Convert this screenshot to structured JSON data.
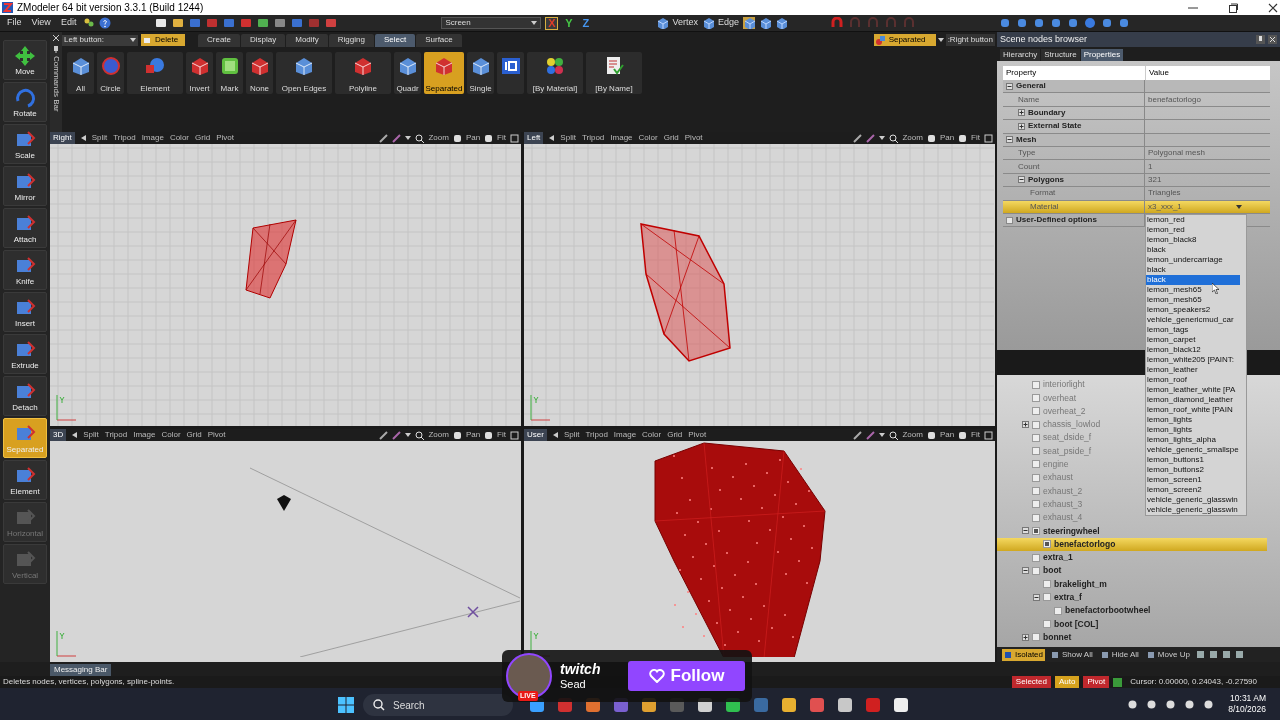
{
  "window": {
    "title": "ZModeler 64 bit version 3.3.1 (Build 1244)"
  },
  "menu": [
    {
      "label": "File"
    },
    {
      "label": "View"
    },
    {
      "label": "Edit"
    }
  ],
  "toolbar": {
    "view_dropdown": "Screen",
    "axes": [
      {
        "label": "X",
        "color": "#e03c28",
        "on": true
      },
      {
        "label": "Y",
        "color": "#46c846",
        "on": false
      },
      {
        "label": "Z",
        "color": "#4696f0",
        "on": false
      }
    ],
    "modes": [
      {
        "label": "Vertex"
      },
      {
        "label": "Edge"
      }
    ]
  },
  "side_tools": [
    {
      "label": "Move",
      "selected": false,
      "disabled": false
    },
    {
      "label": "Rotate",
      "selected": false,
      "disabled": false
    },
    {
      "label": "Scale",
      "selected": false,
      "disabled": false
    },
    {
      "label": "Mirror",
      "selected": false,
      "disabled": false
    },
    {
      "label": "Attach",
      "selected": false,
      "disabled": false
    },
    {
      "label": "Knife",
      "selected": false,
      "disabled": false
    },
    {
      "label": "Insert",
      "selected": false,
      "disabled": false
    },
    {
      "label": "Extrude",
      "selected": false,
      "disabled": false
    },
    {
      "label": "Detach",
      "selected": false,
      "disabled": false
    },
    {
      "label": "Separated",
      "selected": true,
      "disabled": false
    },
    {
      "label": "Element",
      "selected": false,
      "disabled": false
    },
    {
      "label": "Horizontal",
      "selected": false,
      "disabled": true
    },
    {
      "label": "Vertical",
      "selected": false,
      "disabled": true
    }
  ],
  "commands_bar": "Commands Bar",
  "ribbon": {
    "left_button": {
      "label": "Left button:",
      "action": "Delete"
    },
    "tabs": [
      {
        "label": "Create",
        "selected": false
      },
      {
        "label": "Display",
        "selected": false
      },
      {
        "label": "Modify",
        "selected": false
      },
      {
        "label": "Rigging",
        "selected": false
      },
      {
        "label": "Select",
        "selected": true
      },
      {
        "label": "Surface",
        "selected": false
      }
    ],
    "tools": [
      {
        "label": "All",
        "selected": false
      },
      {
        "label": "Circle",
        "selected": false
      },
      {
        "label": "Element",
        "selected": false
      },
      {
        "label": "Invert",
        "selected": false
      },
      {
        "label": "Mark",
        "selected": false
      },
      {
        "label": "None",
        "selected": false
      },
      {
        "label": "Open Edges",
        "selected": false
      },
      {
        "label": "Polyline",
        "selected": false
      },
      {
        "label": "Quadr",
        "selected": false
      },
      {
        "label": "Separated",
        "selected": true
      },
      {
        "label": "Single",
        "selected": false
      },
      {
        "selected": false
      },
      {
        "label": "[By Material]",
        "selected": false
      },
      {
        "label": "[By Name]",
        "selected": false
      }
    ],
    "right_button": {
      "action": "Separated",
      "label": ":Right button"
    }
  },
  "viewports": [
    {
      "name": "Right",
      "kind": "grid-small-mesh",
      "menu": [
        "Split",
        "Tripod",
        "Image",
        "Color",
        "Grid",
        "Pivot"
      ],
      "controls": [
        "Zoom",
        "Pan",
        "Fit"
      ]
    },
    {
      "name": "Left",
      "kind": "grid-tall-mesh",
      "menu": [
        "Split",
        "Tripod",
        "Image",
        "Color",
        "Grid",
        "Pivot"
      ],
      "controls": [
        "Zoom",
        "Pan",
        "Fit"
      ]
    },
    {
      "name": "3D",
      "kind": "scene-gem",
      "menu": [
        "Split",
        "Tripod",
        "Image",
        "Color",
        "Grid",
        "Pivot"
      ],
      "controls": [
        "Zoom",
        "Pan",
        "Fit"
      ]
    },
    {
      "name": "User",
      "kind": "closeup-mesh",
      "menu": [
        "Split",
        "Tripod",
        "Image",
        "Color",
        "Grid",
        "Pivot"
      ],
      "controls": [
        "Zoom",
        "Pan",
        "Fit"
      ]
    }
  ],
  "scene_browser": {
    "title": "Scene nodes browser",
    "tabs": [
      {
        "label": "Hierarchy",
        "selected": false
      },
      {
        "label": "Structure",
        "selected": false
      },
      {
        "label": "Properties",
        "selected": true
      }
    ],
    "columns": [
      "Property",
      "Value"
    ],
    "properties": [
      {
        "kind": "section",
        "label": "General",
        "expanded": true,
        "children": [
          {
            "kind": "field",
            "label": "Name",
            "value": "benefactorlogo",
            "selected": false
          },
          {
            "kind": "group",
            "label": "Boundary",
            "expanded": false,
            "selected": false
          },
          {
            "kind": "group",
            "label": "External State",
            "expanded": false,
            "selected": false
          }
        ]
      },
      {
        "kind": "section",
        "label": "Mesh",
        "expanded": true,
        "children": [
          {
            "kind": "field",
            "label": "Type",
            "value": "Polygonal mesh",
            "selected": false
          },
          {
            "kind": "field",
            "label": "Count",
            "value": "1",
            "selected": false
          },
          {
            "kind": "group",
            "label": "Polygons",
            "value": "321",
            "expanded": true,
            "selected": false,
            "children": [
              {
                "kind": "field",
                "label": "Format",
                "value": "Triangles",
                "selected": false
              },
              {
                "kind": "field",
                "label": "Material",
                "value": "x3_xxx_1",
                "selected": true
              }
            ]
          }
        ]
      },
      {
        "kind": "checkbox",
        "label": "User-Defined options",
        "checked": false
      }
    ],
    "material_options": [
      {
        "label": "lemon_red",
        "selected": false
      },
      {
        "label": "lemon_red",
        "selected": false
      },
      {
        "label": "lemon_black8",
        "selected": false
      },
      {
        "label": "black",
        "selected": false
      },
      {
        "label": "lemon_undercarriage",
        "selected": false
      },
      {
        "label": "black",
        "selected": false
      },
      {
        "label": "black",
        "selected": true
      },
      {
        "label": "lemon_mesh65",
        "selected": false
      },
      {
        "label": "lemon_mesh65",
        "selected": false
      },
      {
        "label": "lemon_speakers2",
        "selected": false
      },
      {
        "label": "vehicle_genericmud_car",
        "selected": false
      },
      {
        "label": "lemon_tags",
        "selected": false
      },
      {
        "label": "lemon_carpet",
        "selected": false
      },
      {
        "label": "lemon_black12",
        "selected": false
      },
      {
        "label": "lemon_white205 [PAINT:",
        "selected": false
      },
      {
        "label": "lemon_leather",
        "selected": false
      },
      {
        "label": "lemon_roof",
        "selected": false
      },
      {
        "label": "lemon_leather_white [PA",
        "selected": false
      },
      {
        "label": "lemon_diamond_leather",
        "selected": false
      },
      {
        "label": "lemon_roof_white [PAIN",
        "selected": false
      },
      {
        "label": "lemon_lights",
        "selected": false
      },
      {
        "label": "lemon_lights",
        "selected": false
      },
      {
        "label": "lemon_lights_alpha",
        "selected": false
      },
      {
        "label": "vehicle_generic_smallspe",
        "selected": false
      },
      {
        "label": "lemon_buttons1",
        "selected": false
      },
      {
        "label": "lemon_buttons2",
        "selected": false
      },
      {
        "label": "lemon_screen1",
        "selected": false
      },
      {
        "label": "lemon_screen2",
        "selected": false
      },
      {
        "label": "vehicle_generic_glasswin",
        "selected": false
      },
      {
        "label": "vehicle_generic_glasswin",
        "selected": false
      }
    ],
    "tree": [
      {
        "label": "interiorlight",
        "hidden": true,
        "checked": false,
        "selected": false
      },
      {
        "label": "overheat",
        "hidden": true,
        "checked": false,
        "selected": false
      },
      {
        "label": "overheat_2",
        "hidden": true,
        "checked": false,
        "selected": false
      },
      {
        "label": "chassis_lowlod",
        "hidden": true,
        "checked": false,
        "selected": false,
        "expanded": false
      },
      {
        "label": "seat_dside_f",
        "hidden": true,
        "checked": false,
        "selected": false
      },
      {
        "label": "seat_pside_f",
        "hidden": true,
        "checked": false,
        "selected": false
      },
      {
        "label": "engine",
        "hidden": true,
        "checked": false,
        "selected": false
      },
      {
        "label": "exhaust",
        "hidden": true,
        "checked": false,
        "selected": false
      },
      {
        "label": "exhaust_2",
        "hidden": true,
        "checked": false,
        "selected": false
      },
      {
        "label": "exhaust_3",
        "hidden": true,
        "checked": false,
        "selected": false
      },
      {
        "label": "exhaust_4",
        "hidden": true,
        "checked": false,
        "selected": false
      },
      {
        "label": "steeringwheel",
        "hidden": false,
        "checked": true,
        "selected": false,
        "expanded": true,
        "children": [
          {
            "label": "benefactorlogo",
            "hidden": false,
            "checked": true,
            "selected": true
          }
        ]
      },
      {
        "label": "extra_1",
        "hidden": false,
        "checked": false,
        "selected": false
      },
      {
        "label": "boot",
        "hidden": false,
        "checked": false,
        "selected": false,
        "expanded": true,
        "children": [
          {
            "label": "brakelight_m",
            "hidden": false,
            "checked": false,
            "selected": false
          },
          {
            "label": "extra_f",
            "hidden": false,
            "checked": false,
            "selected": false,
            "expanded": true,
            "children": [
              {
                "label": "benefactorbootwheel",
                "hidden": false,
                "checked": false,
                "selected": false
              }
            ]
          },
          {
            "label": "boot [COL]",
            "hidden": false,
            "checked": false,
            "selected": false
          }
        ]
      },
      {
        "label": "bonnet",
        "hidden": false,
        "checked": false,
        "selected": false,
        "expanded": false
      }
    ],
    "bottom_buttons": [
      {
        "label": "Isolated",
        "selected": true
      },
      {
        "label": "Show All",
        "selected": false
      },
      {
        "label": "Hide All",
        "selected": false
      },
      {
        "label": "Move Up",
        "selected": false
      }
    ]
  },
  "messaging_bar": "Messaging Bar",
  "status_bar": {
    "message": "Deletes nodes, vertices, polygons, spline-points.",
    "indicators": [
      {
        "label": "Selected",
        "color": "#c0282d"
      },
      {
        "label": "Auto",
        "color": "#d6a21e"
      },
      {
        "label": "Pivot",
        "color": "#c0282d"
      }
    ],
    "cursor": "Cursor: 0.00000, 0.24043, -0.27590"
  },
  "stream_overlay": {
    "platform": "twitch",
    "channel": "Sead",
    "live": "LIVE",
    "follow": "Follow"
  },
  "taskbar": {
    "search": "Search",
    "time": "10:31 AM",
    "date": "8/10/2026"
  }
}
